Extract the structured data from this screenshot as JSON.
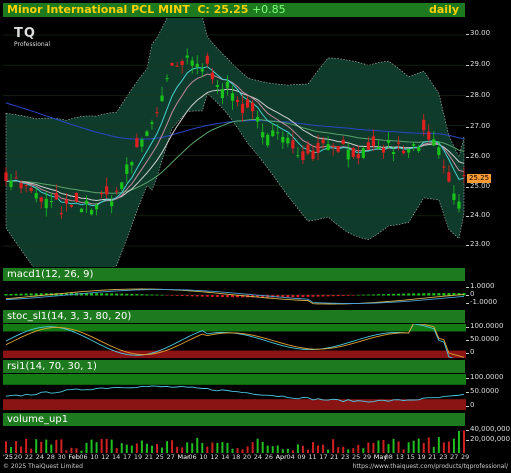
{
  "header": {
    "symbol": "Minor International PCL MINT",
    "close_label": "C: 25.25",
    "change": "+0.85",
    "period": "daily"
  },
  "logo": {
    "text": "TQ",
    "subtitle": "Professional"
  },
  "price_axis": [
    "30.00",
    "29.00",
    "28.00",
    "27.00",
    "26.00",
    "25.00",
    "24.00",
    "23.00"
  ],
  "price_tag": "25.25",
  "panels": {
    "macd": {
      "label": "macd1(12, 26, 9)",
      "axis": [
        "1.0000",
        "0",
        "-1.0000"
      ]
    },
    "stoch": {
      "label": "stoc_sl1(14, 3, 3, 80, 20)",
      "axis": [
        "100.0000",
        "50.0000",
        "0"
      ]
    },
    "rsi": {
      "label": "rsi1(14, 70, 30, 1)",
      "axis": [
        "100.0000",
        "50.0000",
        "0"
      ]
    },
    "volume": {
      "label": "volume_up1",
      "axis": [
        "40,000,000",
        "20,000,000"
      ]
    }
  },
  "x_axis": [
    "'25",
    "20",
    "22",
    "24",
    "28",
    "30",
    "Feb",
    "06",
    "10",
    "12",
    "14",
    "17",
    "19",
    "21",
    "25",
    "27",
    "Mar",
    "06",
    "10",
    "12",
    "14",
    "18",
    "20",
    "24",
    "26",
    "Apr",
    "04",
    "09",
    "11",
    "17",
    "21",
    "23",
    "25",
    "29",
    "May",
    "08",
    "13",
    "15",
    "19",
    "21",
    "23",
    "27",
    "29"
  ],
  "footer": {
    "copyright": "© 2025 ThaiQuest Limited",
    "url": "https://www.thaiquest.com/products/tqprofessional/"
  }
}
